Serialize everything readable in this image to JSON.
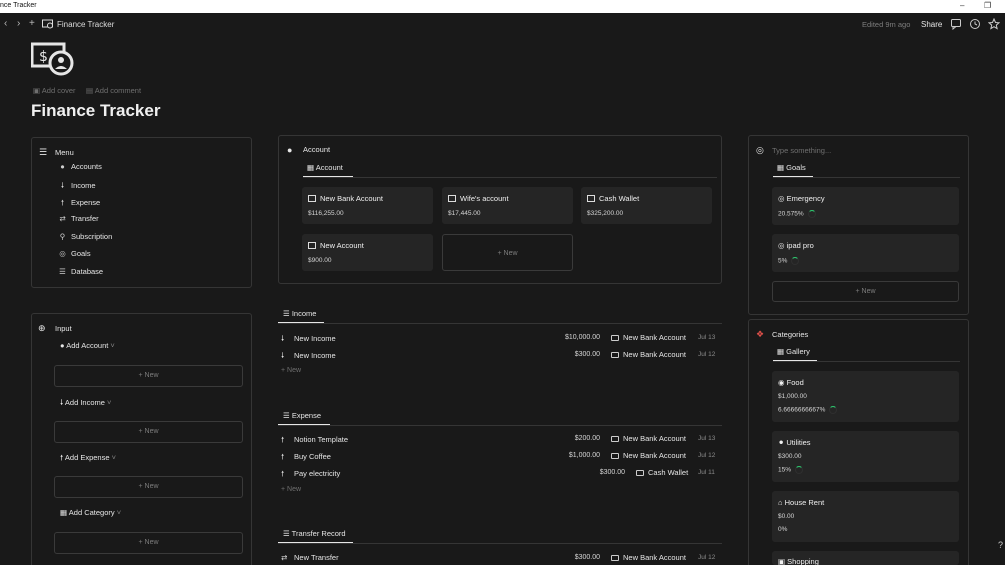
{
  "window": {
    "title": "nce Tracker"
  },
  "topbar": {
    "breadcrumb": "Finance Tracker",
    "edited": "Edited 9m ago",
    "share": "Share"
  },
  "page": {
    "title": "Finance Tracker",
    "add_cover": "Add cover",
    "add_comment": "Add comment"
  },
  "menu": {
    "title": "Menu",
    "items": [
      {
        "label": "Accounts",
        "icon": "person-icon"
      },
      {
        "label": "Income",
        "icon": "arrow-down-icon"
      },
      {
        "label": "Expense",
        "icon": "arrow-up-icon"
      },
      {
        "label": "Transfer",
        "icon": "transfer-icon"
      },
      {
        "label": "Subscription",
        "icon": "subscription-icon"
      },
      {
        "label": "Goals",
        "icon": "target-icon"
      },
      {
        "label": "Database",
        "icon": "database-icon"
      }
    ]
  },
  "input": {
    "title": "Input",
    "groups": [
      {
        "label": "Add Account",
        "new": "New"
      },
      {
        "label": "Add Income",
        "new": "New"
      },
      {
        "label": "Add Expense",
        "new": "New"
      },
      {
        "label": "Add Category",
        "new": "New"
      }
    ]
  },
  "account": {
    "title": "Account",
    "tab": "Account",
    "cards": [
      {
        "name": "New Bank Account",
        "value": "$116,255.00"
      },
      {
        "name": "Wife's account",
        "value": "$17,445.00"
      },
      {
        "name": "Cash Wallet",
        "value": "$325,200.00"
      },
      {
        "name": "New Account",
        "value": "$900.00"
      }
    ],
    "new": "New"
  },
  "income": {
    "tab": "Income",
    "rows": [
      {
        "name": "New Income",
        "amount": "$10,000.00",
        "account": "New Bank Account",
        "date": "Jul 13"
      },
      {
        "name": "New Income",
        "amount": "$300.00",
        "account": "New Bank Account",
        "date": "Jul 12"
      }
    ],
    "new": "New"
  },
  "expense": {
    "tab": "Expense",
    "rows": [
      {
        "name": "Notion Template",
        "amount": "$200.00",
        "account": "New Bank Account",
        "date": "Jul 13"
      },
      {
        "name": "Buy Coffee",
        "amount": "$1,000.00",
        "account": "New Bank Account",
        "date": "Jul 12"
      },
      {
        "name": "Pay electricity",
        "amount": "$300.00",
        "account": "Cash Wallet",
        "date": "Jul 11"
      }
    ],
    "new": "New"
  },
  "transfer": {
    "tab": "Transfer Record",
    "rows": [
      {
        "name": "New Transfer",
        "amount": "$300.00",
        "account": "New Bank Account",
        "date": "Jul 12"
      }
    ]
  },
  "goals": {
    "placeholder": "Type something...",
    "tab": "Goals",
    "cards": [
      {
        "name": "Emergency",
        "value": "20.575%",
        "progress": 0.20575
      },
      {
        "name": "ipad pro",
        "value": "5%",
        "progress": 0.05
      }
    ],
    "new": "New"
  },
  "categories": {
    "title": "Categories",
    "tab": "Gallery",
    "cards": [
      {
        "name": "Food",
        "amount": "$1,000.00",
        "value": "6.6666666667%"
      },
      {
        "name": "Utilities",
        "amount": "$300.00",
        "value": "15%"
      },
      {
        "name": "House Rent",
        "amount": "$0.00",
        "value": "0%"
      },
      {
        "name": "Shopping"
      }
    ]
  },
  "colors": {
    "background": "#191919",
    "card": "#252525",
    "progress": "#2ecc71"
  },
  "help": "?"
}
